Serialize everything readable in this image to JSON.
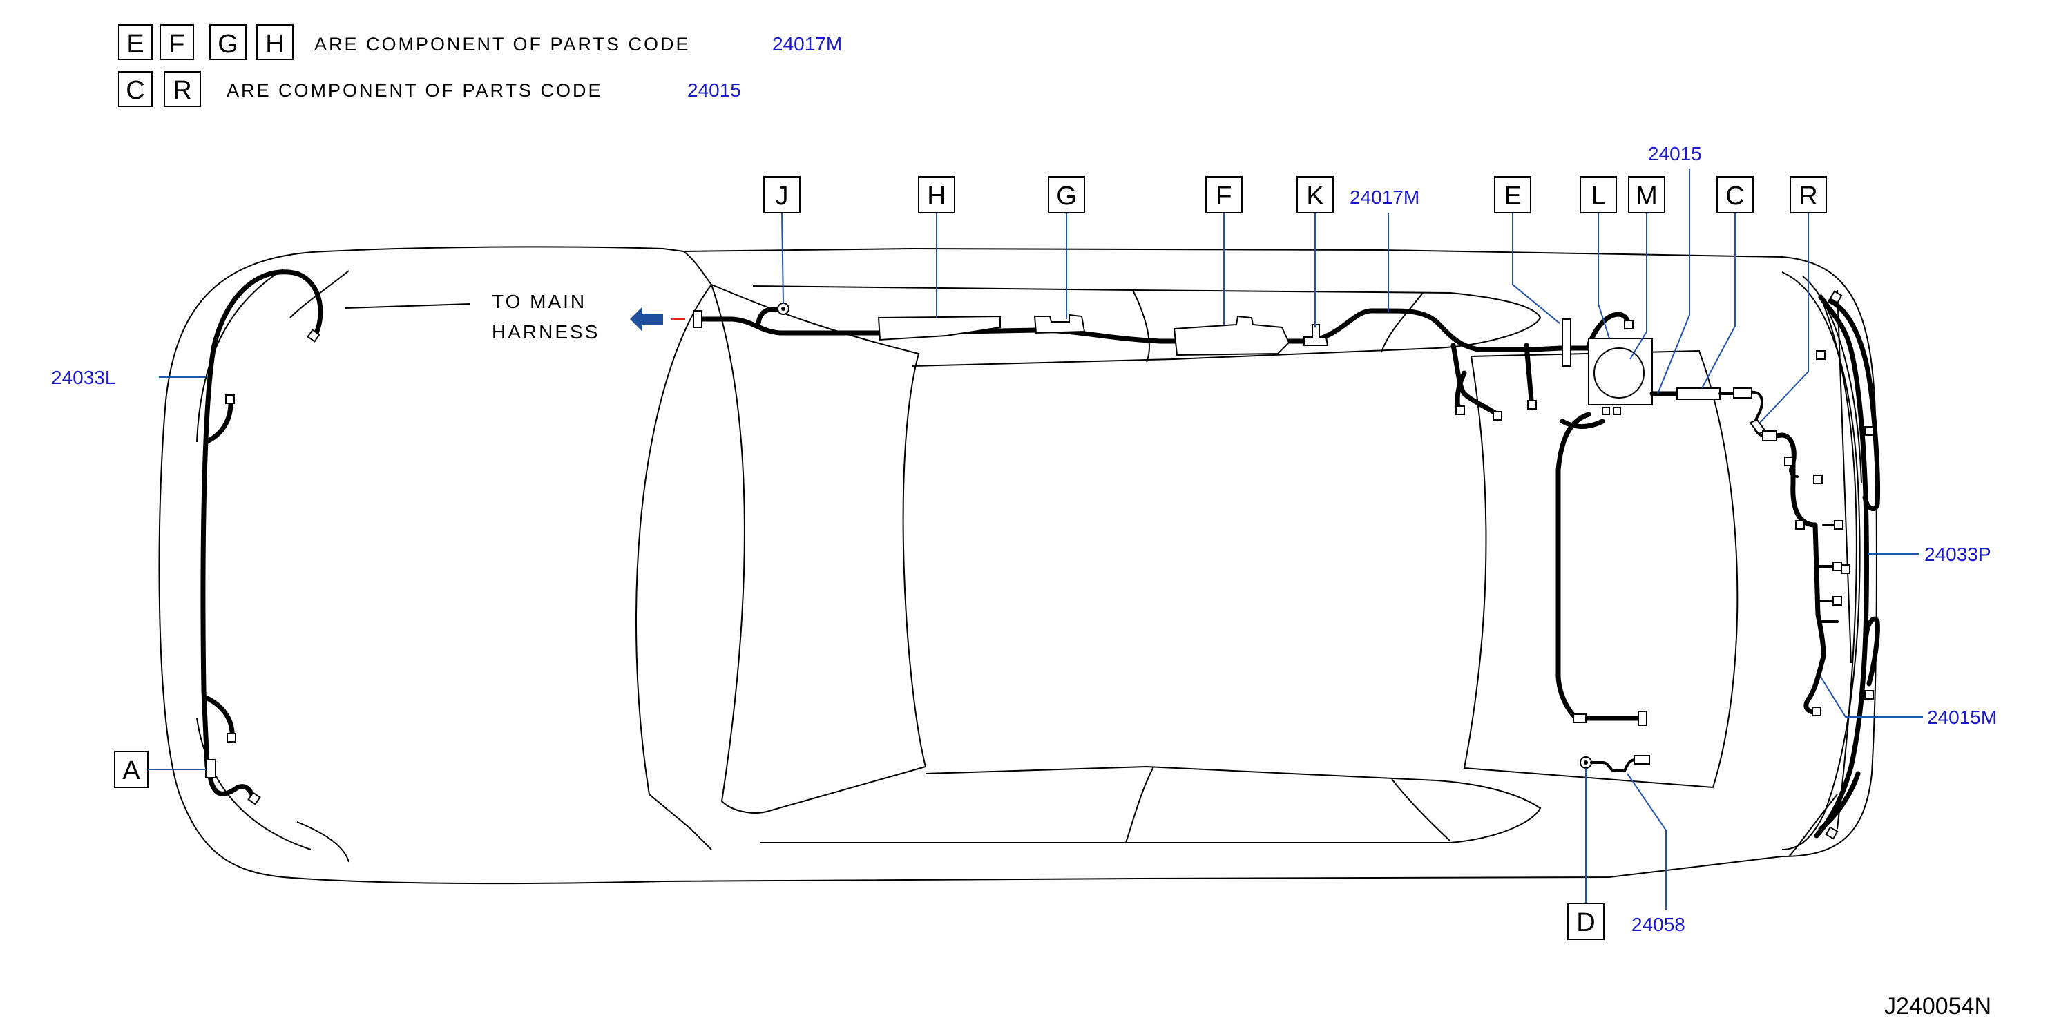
{
  "legend": {
    "row1": {
      "letters": [
        "E",
        "F",
        "G",
        "H"
      ],
      "text": "ARE COMPONENT OF PARTS CODE",
      "code": "24017M"
    },
    "row2": {
      "letters": [
        "C",
        "R"
      ],
      "text": "ARE COMPONENT OF PARTS CODE",
      "code": "24015"
    }
  },
  "harness_note": {
    "line1": "TO MAIN",
    "line2": "HARNESS",
    "arrow_color": "#1f4f9c"
  },
  "top_labels": [
    "J",
    "H",
    "G",
    "F",
    "K",
    "E",
    "L",
    "M",
    "C",
    "R"
  ],
  "side_labels": {
    "A": "A",
    "D": "D"
  },
  "part_codes": {
    "p24017M": "24017M",
    "p24015": "24015",
    "p24033L": "24033L",
    "p24033P": "24033P",
    "p24015M": "24015M",
    "p24058": "24058"
  },
  "drawing_id": "J240054N",
  "colors": {
    "part_code": "#1a1acc",
    "leader": "#2255aa",
    "wire": "#000000"
  }
}
